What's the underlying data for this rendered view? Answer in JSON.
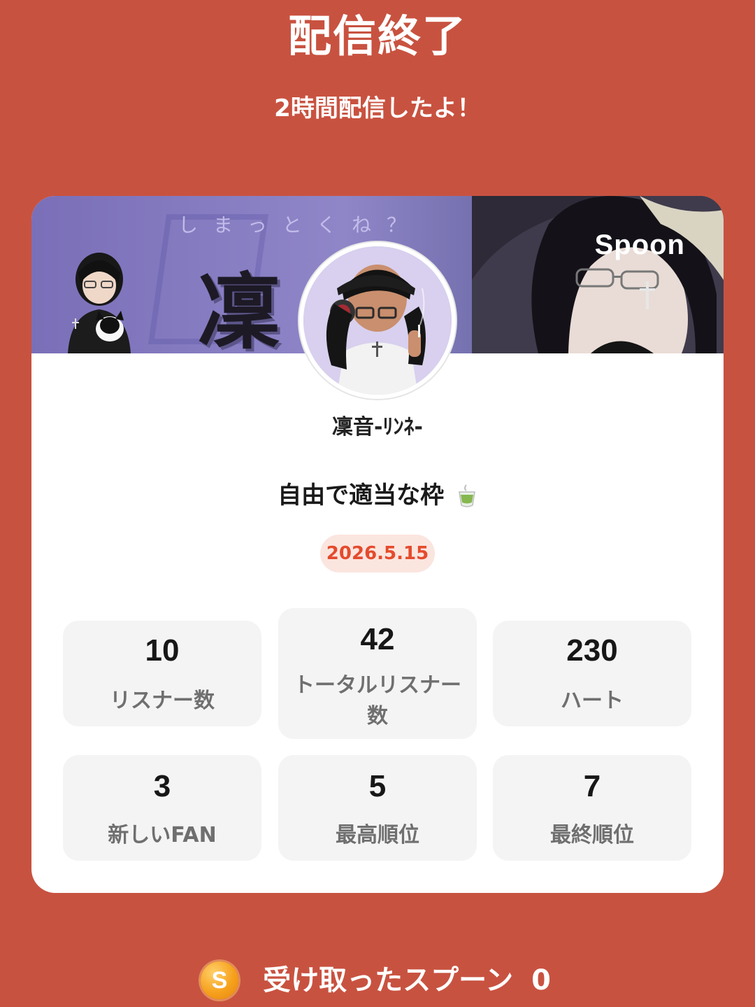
{
  "header": {
    "title": "配信終了",
    "subtitle": "2時間配信したよ！"
  },
  "card": {
    "banner": {
      "brand": "Spoon",
      "kanji": "凜",
      "caption": "しまっとくね？"
    },
    "username": "凜音-ﾘﾝﾈ-",
    "stream_title": "自由で適当な枠",
    "date": "2026.5.15",
    "stats": [
      {
        "value": "10",
        "label": "リスナー数"
      },
      {
        "value": "42",
        "label": "トータルリスナー数"
      },
      {
        "value": "230",
        "label": "ハート"
      },
      {
        "value": "3",
        "label": "新しいFAN"
      },
      {
        "value": "5",
        "label": "最高順位"
      },
      {
        "value": "7",
        "label": "最終順位"
      }
    ]
  },
  "footer": {
    "coin_letter": "S",
    "label": "受け取ったスプーン",
    "value": "0"
  },
  "colors": {
    "background": "#c85240",
    "accent": "#e44b2c",
    "date_bg": "#fbe5df",
    "stat_bg": "#f4f4f4"
  },
  "icons": [
    "tea-cup-icon",
    "spoon-coin-icon"
  ]
}
